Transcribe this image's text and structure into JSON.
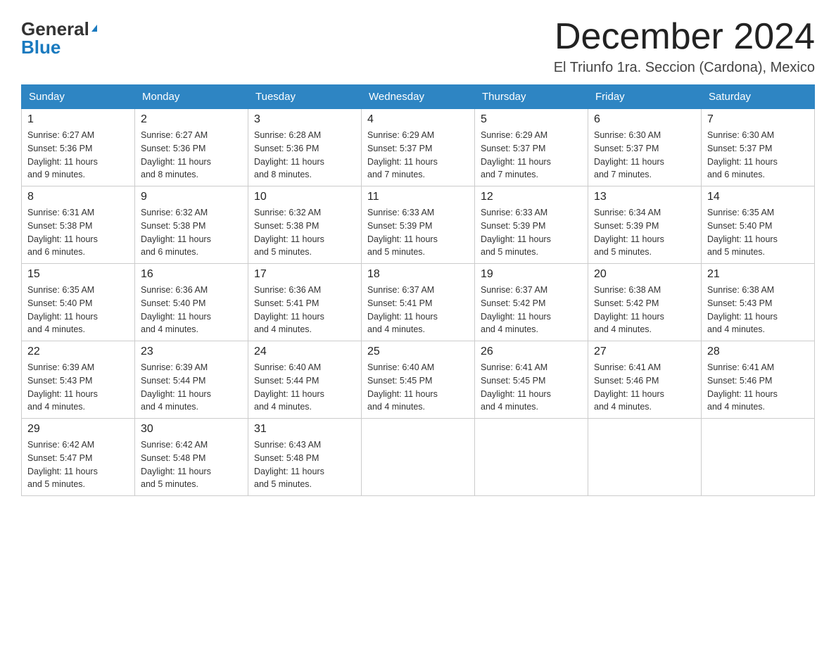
{
  "logo": {
    "general": "General",
    "blue": "Blue",
    "triangle": "▶"
  },
  "header": {
    "month_title": "December 2024",
    "location": "El Triunfo 1ra. Seccion (Cardona), Mexico"
  },
  "days_of_week": [
    "Sunday",
    "Monday",
    "Tuesday",
    "Wednesday",
    "Thursday",
    "Friday",
    "Saturday"
  ],
  "weeks": [
    [
      {
        "day": "1",
        "sunrise": "6:27 AM",
        "sunset": "5:36 PM",
        "daylight_h": "11",
        "daylight_m": "9"
      },
      {
        "day": "2",
        "sunrise": "6:27 AM",
        "sunset": "5:36 PM",
        "daylight_h": "11",
        "daylight_m": "8"
      },
      {
        "day": "3",
        "sunrise": "6:28 AM",
        "sunset": "5:36 PM",
        "daylight_h": "11",
        "daylight_m": "8"
      },
      {
        "day": "4",
        "sunrise": "6:29 AM",
        "sunset": "5:37 PM",
        "daylight_h": "11",
        "daylight_m": "7"
      },
      {
        "day": "5",
        "sunrise": "6:29 AM",
        "sunset": "5:37 PM",
        "daylight_h": "11",
        "daylight_m": "7"
      },
      {
        "day": "6",
        "sunrise": "6:30 AM",
        "sunset": "5:37 PM",
        "daylight_h": "11",
        "daylight_m": "7"
      },
      {
        "day": "7",
        "sunrise": "6:30 AM",
        "sunset": "5:37 PM",
        "daylight_h": "11",
        "daylight_m": "6"
      }
    ],
    [
      {
        "day": "8",
        "sunrise": "6:31 AM",
        "sunset": "5:38 PM",
        "daylight_h": "11",
        "daylight_m": "6"
      },
      {
        "day": "9",
        "sunrise": "6:32 AM",
        "sunset": "5:38 PM",
        "daylight_h": "11",
        "daylight_m": "6"
      },
      {
        "day": "10",
        "sunrise": "6:32 AM",
        "sunset": "5:38 PM",
        "daylight_h": "11",
        "daylight_m": "5"
      },
      {
        "day": "11",
        "sunrise": "6:33 AM",
        "sunset": "5:39 PM",
        "daylight_h": "11",
        "daylight_m": "5"
      },
      {
        "day": "12",
        "sunrise": "6:33 AM",
        "sunset": "5:39 PM",
        "daylight_h": "11",
        "daylight_m": "5"
      },
      {
        "day": "13",
        "sunrise": "6:34 AM",
        "sunset": "5:39 PM",
        "daylight_h": "11",
        "daylight_m": "5"
      },
      {
        "day": "14",
        "sunrise": "6:35 AM",
        "sunset": "5:40 PM",
        "daylight_h": "11",
        "daylight_m": "5"
      }
    ],
    [
      {
        "day": "15",
        "sunrise": "6:35 AM",
        "sunset": "5:40 PM",
        "daylight_h": "11",
        "daylight_m": "4"
      },
      {
        "day": "16",
        "sunrise": "6:36 AM",
        "sunset": "5:40 PM",
        "daylight_h": "11",
        "daylight_m": "4"
      },
      {
        "day": "17",
        "sunrise": "6:36 AM",
        "sunset": "5:41 PM",
        "daylight_h": "11",
        "daylight_m": "4"
      },
      {
        "day": "18",
        "sunrise": "6:37 AM",
        "sunset": "5:41 PM",
        "daylight_h": "11",
        "daylight_m": "4"
      },
      {
        "day": "19",
        "sunrise": "6:37 AM",
        "sunset": "5:42 PM",
        "daylight_h": "11",
        "daylight_m": "4"
      },
      {
        "day": "20",
        "sunrise": "6:38 AM",
        "sunset": "5:42 PM",
        "daylight_h": "11",
        "daylight_m": "4"
      },
      {
        "day": "21",
        "sunrise": "6:38 AM",
        "sunset": "5:43 PM",
        "daylight_h": "11",
        "daylight_m": "4"
      }
    ],
    [
      {
        "day": "22",
        "sunrise": "6:39 AM",
        "sunset": "5:43 PM",
        "daylight_h": "11",
        "daylight_m": "4"
      },
      {
        "day": "23",
        "sunrise": "6:39 AM",
        "sunset": "5:44 PM",
        "daylight_h": "11",
        "daylight_m": "4"
      },
      {
        "day": "24",
        "sunrise": "6:40 AM",
        "sunset": "5:44 PM",
        "daylight_h": "11",
        "daylight_m": "4"
      },
      {
        "day": "25",
        "sunrise": "6:40 AM",
        "sunset": "5:45 PM",
        "daylight_h": "11",
        "daylight_m": "4"
      },
      {
        "day": "26",
        "sunrise": "6:41 AM",
        "sunset": "5:45 PM",
        "daylight_h": "11",
        "daylight_m": "4"
      },
      {
        "day": "27",
        "sunrise": "6:41 AM",
        "sunset": "5:46 PM",
        "daylight_h": "11",
        "daylight_m": "4"
      },
      {
        "day": "28",
        "sunrise": "6:41 AM",
        "sunset": "5:46 PM",
        "daylight_h": "11",
        "daylight_m": "4"
      }
    ],
    [
      {
        "day": "29",
        "sunrise": "6:42 AM",
        "sunset": "5:47 PM",
        "daylight_h": "11",
        "daylight_m": "5"
      },
      {
        "day": "30",
        "sunrise": "6:42 AM",
        "sunset": "5:48 PM",
        "daylight_h": "11",
        "daylight_m": "5"
      },
      {
        "day": "31",
        "sunrise": "6:43 AM",
        "sunset": "5:48 PM",
        "daylight_h": "11",
        "daylight_m": "5"
      },
      null,
      null,
      null,
      null
    ]
  ],
  "labels": {
    "sunrise": "Sunrise:",
    "sunset": "Sunset:",
    "daylight": "Daylight:",
    "hours": "hours",
    "and": "and",
    "minutes": "minutes."
  }
}
